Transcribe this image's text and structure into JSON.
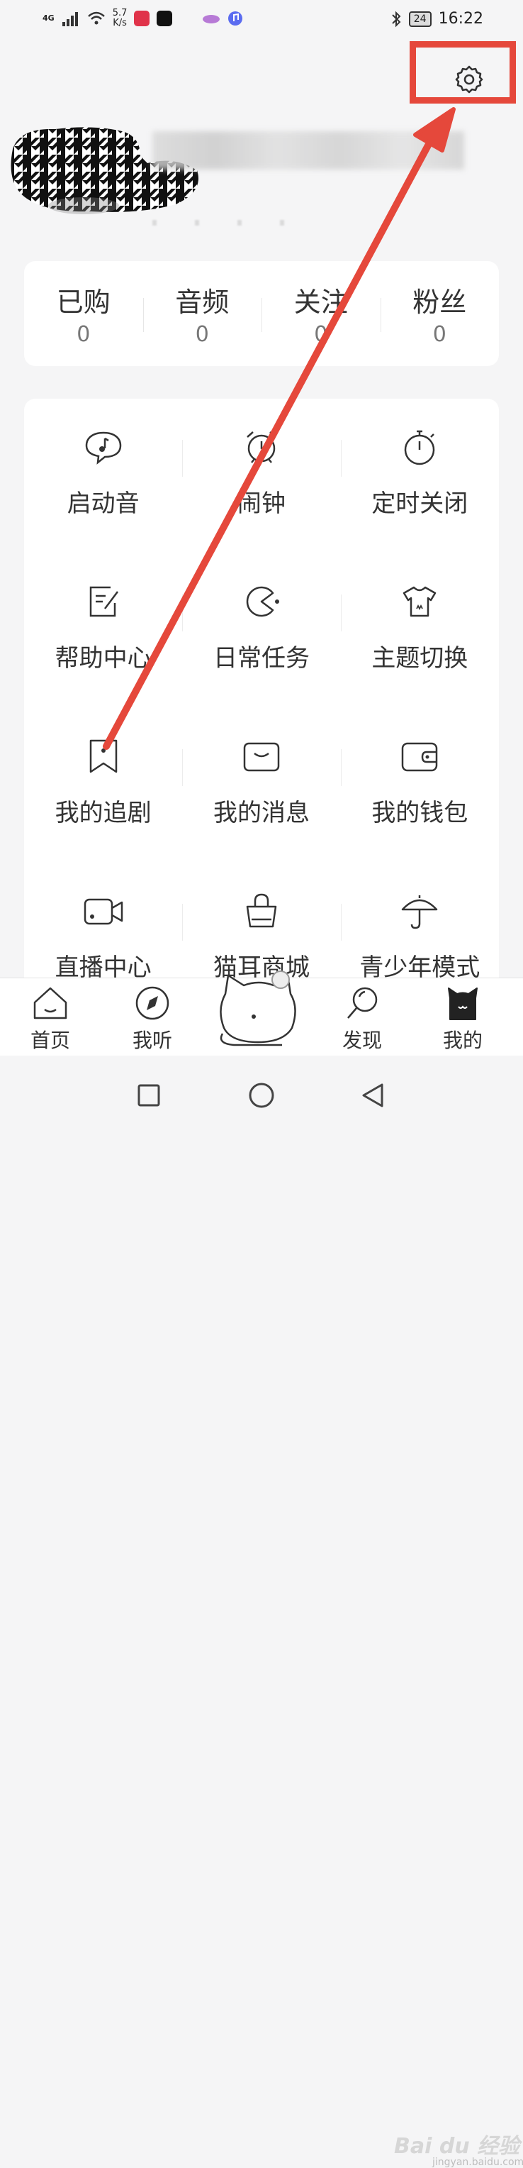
{
  "status_bar": {
    "network": "4G",
    "speed_value": "5.7",
    "speed_unit": "K/s",
    "battery": "24",
    "time": "16:22"
  },
  "stats": [
    {
      "label": "已购",
      "value": "0"
    },
    {
      "label": "音频",
      "value": "0"
    },
    {
      "label": "关注",
      "value": "0"
    },
    {
      "label": "粉丝",
      "value": "0"
    }
  ],
  "menu": [
    {
      "label": "启动音",
      "icon": "speech-bubble-music-icon"
    },
    {
      "label": "闹钟",
      "icon": "alarm-clock-icon"
    },
    {
      "label": "定时关闭",
      "icon": "stopwatch-icon"
    },
    {
      "label": "帮助中心",
      "icon": "note-edit-icon"
    },
    {
      "label": "日常任务",
      "icon": "pacman-icon"
    },
    {
      "label": "主题切换",
      "icon": "tshirt-icon"
    },
    {
      "label": "我的追剧",
      "icon": "bookmark-icon"
    },
    {
      "label": "我的消息",
      "icon": "envelope-icon"
    },
    {
      "label": "我的钱包",
      "icon": "wallet-icon"
    },
    {
      "label": "直播中心",
      "icon": "video-camera-icon"
    },
    {
      "label": "猫耳商城",
      "icon": "shopping-bag-icon"
    },
    {
      "label": "青少年模式",
      "icon": "umbrella-icon"
    }
  ],
  "bottom_nav": [
    {
      "label": "首页",
      "icon": "home-icon"
    },
    {
      "label": "我听",
      "icon": "compass-icon"
    },
    {
      "label": "发现",
      "icon": "magnifier-icon"
    },
    {
      "label": "我的",
      "icon": "cat-ghost-icon",
      "active": true
    }
  ],
  "watermark": {
    "text": "Bai du 经验",
    "sub": "jingyan.baidu.com"
  },
  "colors": {
    "annotation": "#e5483b",
    "background": "#f5f5f6",
    "card": "#ffffff",
    "text": "#333333"
  }
}
